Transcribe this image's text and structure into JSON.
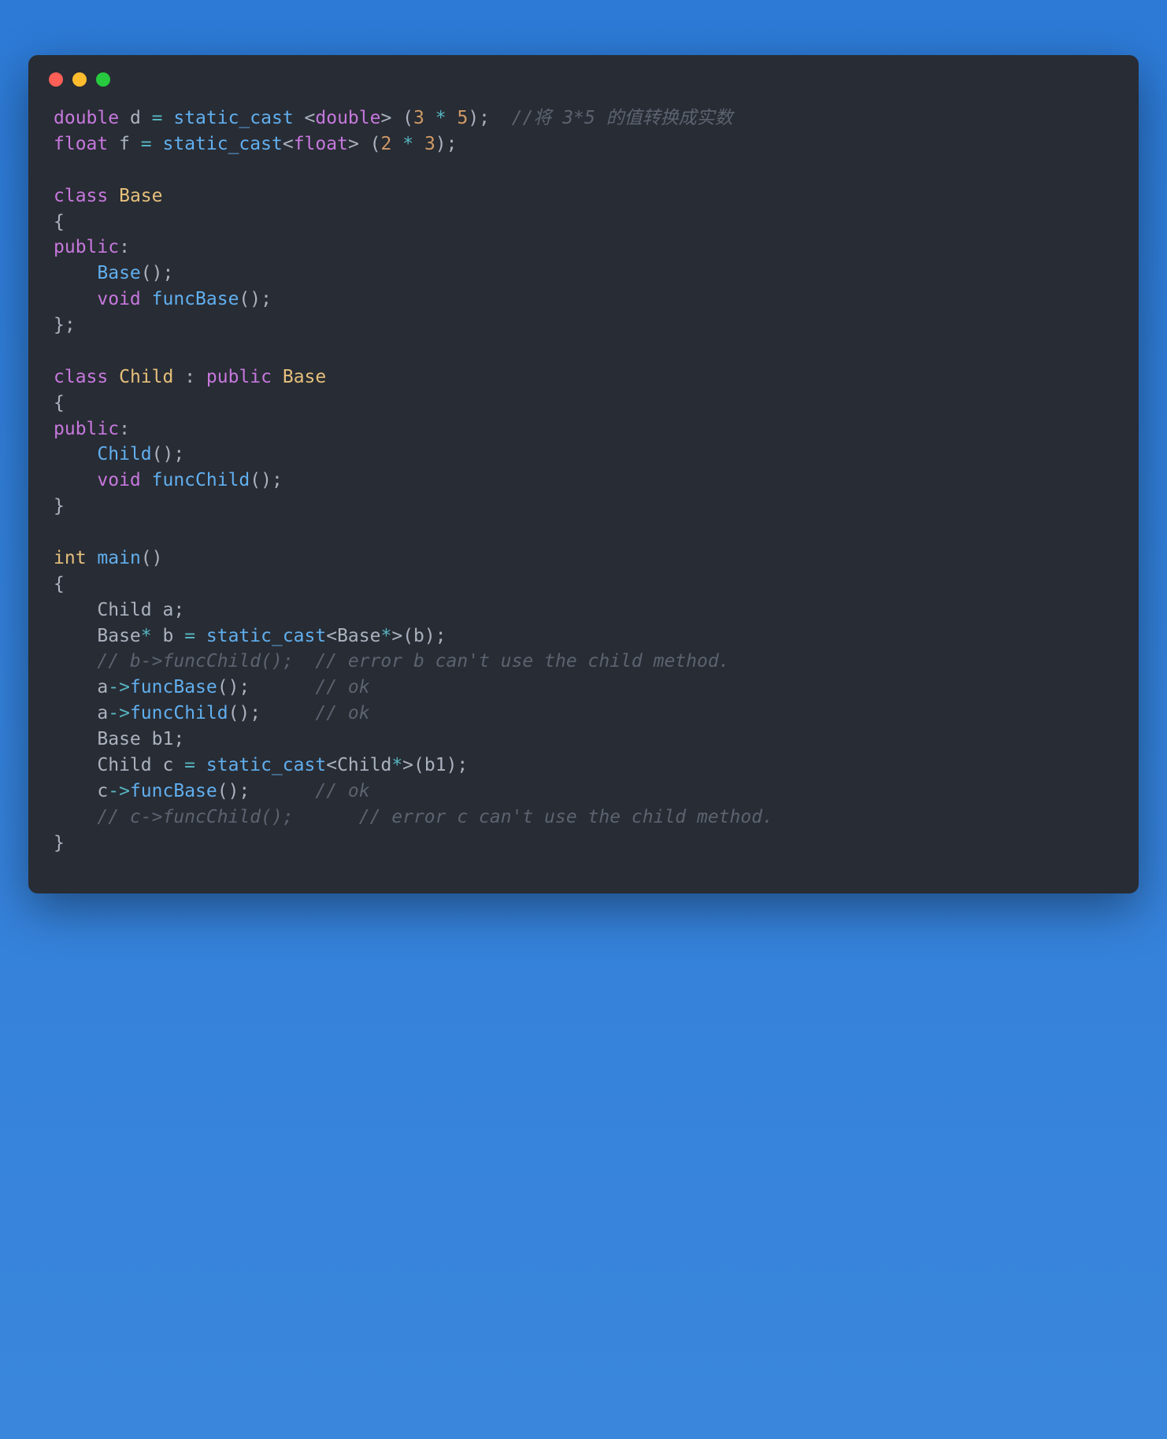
{
  "titlebar": {
    "dots": [
      "red",
      "yellow",
      "green"
    ]
  },
  "code": {
    "l1": {
      "t1": "double",
      "t2": " d ",
      "t3": "=",
      "t4": " static_cast ",
      "t5": "<",
      "t6": "double",
      "t7": ">",
      "t8": " (",
      "t9": "3",
      "t10": " ",
      "t11": "*",
      "t12": " ",
      "t13": "5",
      "t14": ");  ",
      "t15": "//将 3*5 的值转换成实数"
    },
    "l2": {
      "t1": "float",
      "t2": " f ",
      "t3": "=",
      "t4": " static_cast",
      "t5": "<",
      "t6": "float",
      "t7": ">",
      "t8": " (",
      "t9": "2",
      "t10": " ",
      "t11": "*",
      "t12": " ",
      "t13": "3",
      "t14": ");"
    },
    "l3": "",
    "l4": {
      "t1": "class",
      "t2": " ",
      "t3": "Base"
    },
    "l5": "{",
    "l6": {
      "t1": "public",
      "t2": ":"
    },
    "l7": {
      "t1": "    ",
      "t2": "Base",
      "t3": "();"
    },
    "l8": {
      "t1": "    ",
      "t2": "void",
      "t3": " ",
      "t4": "funcBase",
      "t5": "();"
    },
    "l9": "};",
    "l10": "",
    "l11": {
      "t1": "class",
      "t2": " ",
      "t3": "Child",
      "t4": " : ",
      "t5": "public",
      "t6": " ",
      "t7": "Base"
    },
    "l12": "{",
    "l13": {
      "t1": "public",
      "t2": ":"
    },
    "l14": {
      "t1": "    ",
      "t2": "Child",
      "t3": "();"
    },
    "l15": {
      "t1": "    ",
      "t2": "void",
      "t3": " ",
      "t4": "funcChild",
      "t5": "();"
    },
    "l16": "}",
    "l17": "",
    "l18": {
      "t1": "int",
      "t2": " ",
      "t3": "main",
      "t4": "()"
    },
    "l19": "{",
    "l20": {
      "t1": "    Child a;"
    },
    "l21": {
      "t1": "    Base",
      "t2": "*",
      "t3": " b ",
      "t4": "=",
      "t5": " static_cast",
      "t6": "<",
      "t7": "Base",
      "t8": "*",
      "t9": ">",
      "t10": "(b);"
    },
    "l22": {
      "t1": "    ",
      "t2": "// b->funcChild();  // error b can't use the child method."
    },
    "l23": {
      "t1": "    a",
      "t2": "->",
      "t3": "funcBase",
      "t4": "();      ",
      "t5": "// ok"
    },
    "l24": {
      "t1": "    a",
      "t2": "->",
      "t3": "funcChild",
      "t4": "();     ",
      "t5": "// ok"
    },
    "l25": {
      "t1": "    Base b1;"
    },
    "l26": {
      "t1": "    Child c ",
      "t2": "=",
      "t3": " static_cast",
      "t4": "<",
      "t5": "Child",
      "t6": "*",
      "t7": ">",
      "t8": "(b1);"
    },
    "l27": {
      "t1": "    c",
      "t2": "->",
      "t3": "funcBase",
      "t4": "();      ",
      "t5": "// ok"
    },
    "l28": {
      "t1": "    ",
      "t2": "// c->funcChild();      // error c can't use the child method."
    },
    "l29": "}"
  }
}
